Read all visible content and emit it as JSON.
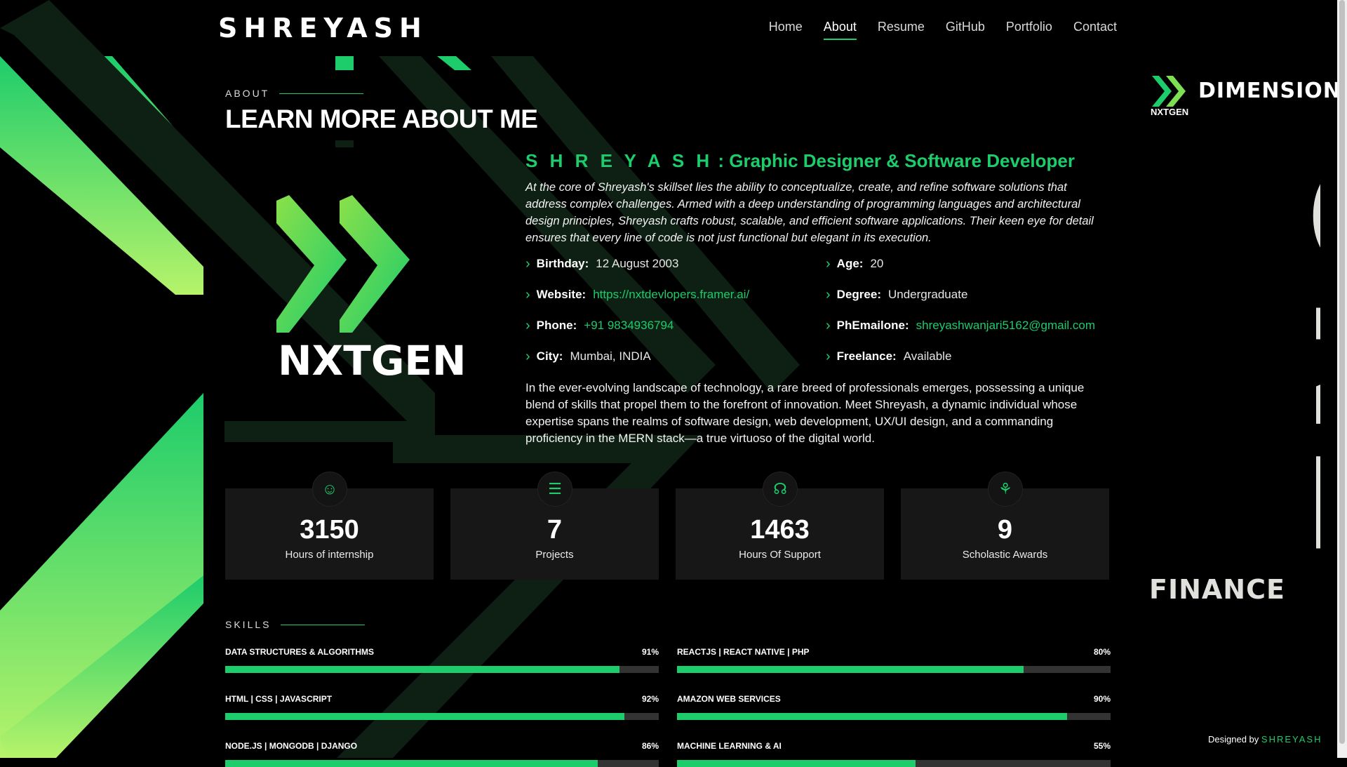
{
  "brand": "SHREYASH",
  "nav": [
    "Home",
    "About",
    "Resume",
    "GitHub",
    "Portfolio",
    "Contact"
  ],
  "about": {
    "section_label": "ABOUT",
    "section_title": "LEARN MORE ABOUT ME",
    "logo_text": "NXTGEN",
    "heading_name": "S H R E Y A S H",
    "heading_role": ": Graphic Designer & Software Developer",
    "intro": "At the core of Shreyash's skillset lies the ability to conceptualize, create, and refine software solutions that address complex challenges. Armed with a deep understanding of programming languages and architectural design principles, Shreyash crafts robust, scalable, and efficient software applications. Their keen eye for detail ensures that every line of code is not just functional but elegant in its execution.",
    "details": [
      {
        "label": "Birthday:",
        "value": "12 August 2003"
      },
      {
        "label": "Age:",
        "value": "20"
      },
      {
        "label": "Website:",
        "value": "https://nxtdevlopers.framer.ai/"
      },
      {
        "label": "Degree:",
        "value": "Undergraduate"
      },
      {
        "label": "Phone:",
        "value": "+91 9834936794"
      },
      {
        "label": "PhEmailone:",
        "value": "shreyashwanjari5162@gmail.com"
      },
      {
        "label": "City:",
        "value": "Mumbai, INDIA"
      },
      {
        "label": "Freelance:",
        "value": "Available"
      }
    ],
    "bio": "In the ever-evolving landscape of technology, a rare breed of professionals emerges, possessing a unique blend of skills that propel them to the forefront of innovation. Meet Shreyash, a dynamic individual whose expertise spans the realms of software design, web development, UX/UI design, and a commanding proficiency in the MERN stack—a true virtuoso of the digital world."
  },
  "stats": [
    {
      "icon": "smiley-icon",
      "value": "3150",
      "label": "Hours of internship"
    },
    {
      "icon": "journal-icon",
      "value": "7",
      "label": "Projects"
    },
    {
      "icon": "headset-icon",
      "value": "1463",
      "label": "Hours Of Support"
    },
    {
      "icon": "award-icon",
      "value": "9",
      "label": "Scholastic Awards"
    }
  ],
  "skills": {
    "label": "SKILLS",
    "items": [
      {
        "name": "DATA STRUCTURES & ALGORITHMS",
        "pct": "91%",
        "level": 91
      },
      {
        "name": "REACTJS | REACT NATIVE | PHP",
        "pct": "80%",
        "level": 80
      },
      {
        "name": "HTML | CSS | JAVASCRIPT",
        "pct": "92%",
        "level": 92
      },
      {
        "name": "AMAZON WEB SERVICES",
        "pct": "90%",
        "level": 90
      },
      {
        "name": "NODE.JS | MONGODB | DJANGO",
        "pct": "86%",
        "level": 86
      },
      {
        "name": "MACHINE LEARNING & AI",
        "pct": "55%",
        "level": 55
      }
    ]
  },
  "side": {
    "logo_title": "DIMENSION",
    "logo_sub": "NXTGEN",
    "big_word": "ONE",
    "finance": "FINANCE"
  },
  "footer": {
    "credit_prefix": "Designed by",
    "credit_name": "SHREYASH"
  },
  "colors": {
    "accent": "#1dcc6b",
    "background": "#000000",
    "card": "#171717"
  }
}
